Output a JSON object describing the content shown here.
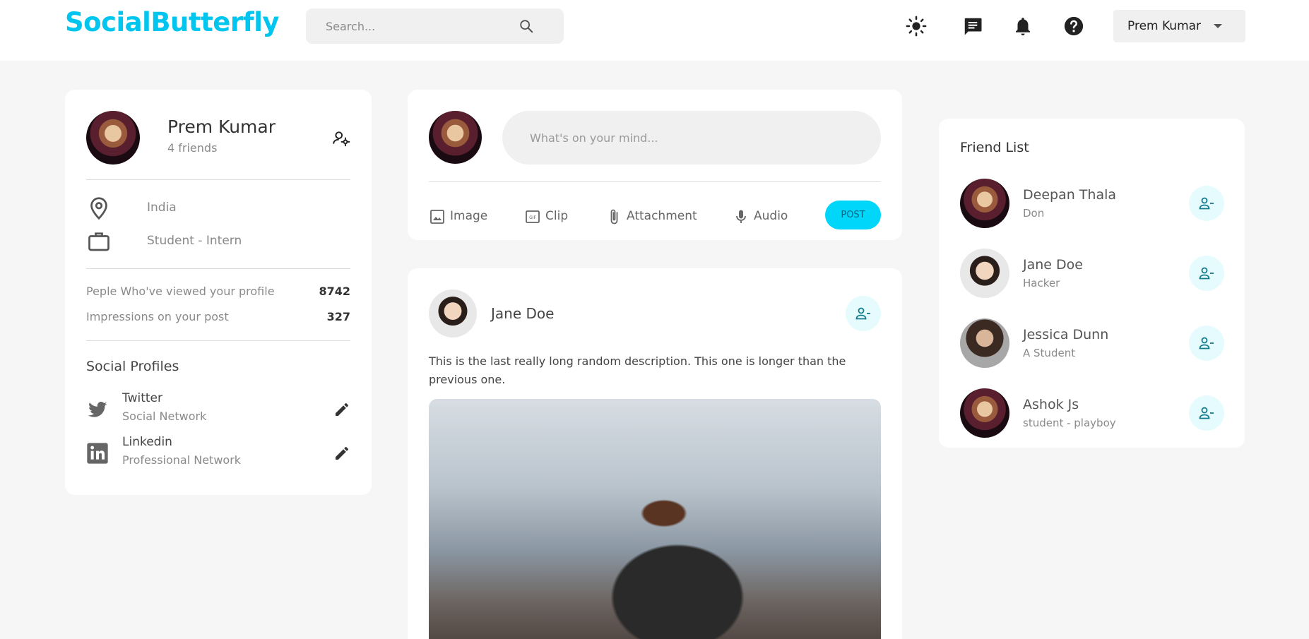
{
  "brand": {
    "name": "SocialButterfly",
    "color": "#00c5ee"
  },
  "header": {
    "search_placeholder": "Search...",
    "icons": [
      "sun-icon",
      "chat-icon",
      "bell-icon",
      "help-icon"
    ],
    "user_select": "Prem Kumar"
  },
  "profile": {
    "name": "Prem Kumar",
    "friends": "4 friends",
    "location": "India",
    "occupation": "Student - Intern",
    "stats": [
      {
        "label": "Peple Who've viewed your profile",
        "value": "8742"
      },
      {
        "label": "Impressions on your post",
        "value": "327"
      }
    ],
    "social_title": "Social Profiles",
    "socials": [
      {
        "name": "Twitter",
        "sub": "Social Network"
      },
      {
        "name": "Linkedin",
        "sub": "Professional Network"
      }
    ]
  },
  "composer": {
    "placeholder": "What's on your mind...",
    "tools": [
      "Image",
      "Clip",
      "Attachment",
      "Audio"
    ],
    "post_label": "POST",
    "accent": "#00d5fa"
  },
  "post": {
    "author": "Jane Doe",
    "description": "This is the last really long random description. This one is longer than the previous one."
  },
  "friend_list": {
    "title": "Friend List",
    "friends": [
      {
        "name": "Deepan Thala",
        "sub": "Don"
      },
      {
        "name": "Jane Doe",
        "sub": "Hacker"
      },
      {
        "name": "Jessica Dunn",
        "sub": "A Student"
      },
      {
        "name": "Ashok Js",
        "sub": "student - playboy"
      }
    ]
  }
}
